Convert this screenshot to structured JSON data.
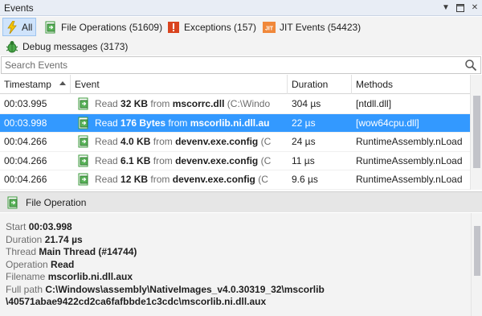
{
  "window": {
    "title": "Events"
  },
  "filters": {
    "all": "All",
    "file_operations": "File Operations (51609)",
    "exceptions": "Exceptions (157)",
    "jit_events": "JIT Events (54423)",
    "debug_messages": "Debug messages (3173)"
  },
  "search": {
    "placeholder": "Search Events"
  },
  "table": {
    "headers": {
      "timestamp": "Timestamp",
      "event": "Event",
      "duration": "Duration",
      "methods": "Methods"
    },
    "rows": [
      {
        "timestamp": "00:03.995",
        "verb": "Read",
        "size": "32 KB",
        "from": "from",
        "file": "mscorrc.dll",
        "path": "(C:\\Windo",
        "duration": "304 µs",
        "method": "[ntdll.dll]"
      },
      {
        "timestamp": "00:03.998",
        "verb": "Read",
        "size": "176 Bytes",
        "from": "from",
        "file": "mscorlib.ni.dll.au",
        "path": "",
        "duration": "22 µs",
        "method": "[wow64cpu.dll]"
      },
      {
        "timestamp": "00:04.266",
        "verb": "Read",
        "size": "4.0 KB",
        "from": "from",
        "file": "devenv.exe.config",
        "path": "(C",
        "duration": "24 µs",
        "method": "RuntimeAssembly.nLoad"
      },
      {
        "timestamp": "00:04.266",
        "verb": "Read",
        "size": "6.1 KB",
        "from": "from",
        "file": "devenv.exe.config",
        "path": "(C",
        "duration": "11 µs",
        "method": "RuntimeAssembly.nLoad"
      },
      {
        "timestamp": "00:04.266",
        "verb": "Read",
        "size": "12 KB",
        "from": "from",
        "file": "devenv.exe.config",
        "path": "(C",
        "duration": "9.6 µs",
        "method": "RuntimeAssembly.nLoad"
      }
    ],
    "selected_index": 1
  },
  "details": {
    "title": "File Operation",
    "fields": [
      {
        "label": "Start",
        "value": "00:03.998"
      },
      {
        "label": "Duration",
        "value": "21.74 µs"
      },
      {
        "label": "Thread",
        "value": "Main Thread (#14744)"
      },
      {
        "label": "Operation",
        "value": "Read"
      },
      {
        "label": "Filename",
        "value": "mscorlib.ni.dll.aux"
      },
      {
        "label": "Full path",
        "value": "C:\\Windows\\assembly\\NativeImages_v4.0.30319_32\\mscorlib"
      }
    ],
    "path_continuation": "\\40571abae9422cd2ca6fafbbde1c3cdc\\mscorlib.ni.dll.aux"
  },
  "colors": {
    "selection": "#3399ff",
    "active_filter": "#cfe3fb",
    "exception_icon": "#d9441f",
    "jit_icon": "#f0883a",
    "file_icon": "#3a9a3a"
  }
}
